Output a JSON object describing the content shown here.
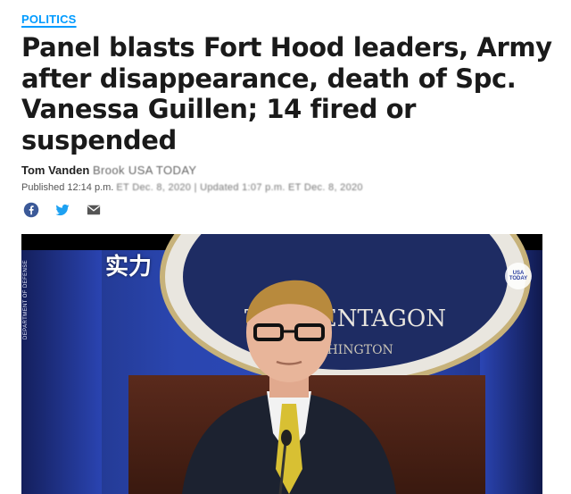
{
  "section": {
    "label": "POLITICS"
  },
  "headline": "Panel blasts Fort Hood leaders, Army after disappearance, death of Spc. Vanessa Guillen; 14 fired or suspended",
  "byline": {
    "author": "Tom Vanden",
    "rest": "Brook USA TODAY"
  },
  "dateline": {
    "published": "Published 12:14 p.m.",
    "rest": "ET Dec. 8, 2020 | Updated 1:07 p.m. ET Dec. 8, 2020"
  },
  "share": {
    "icons": [
      "facebook-icon",
      "twitter-icon",
      "email-icon"
    ],
    "colors": {
      "facebook": "#3b5998",
      "twitter": "#1da1f2",
      "email": "#555555"
    }
  },
  "video": {
    "overlay_text": "实力",
    "seal_text_line1": "THE PENTAGON",
    "seal_text_line2": "WASHINGTON",
    "watermark": "USA TODAY",
    "side_credit": "DEPARTMENT OF DEFENSE"
  },
  "colors": {
    "accent": "#009bff",
    "headline": "#1a1a1a"
  }
}
